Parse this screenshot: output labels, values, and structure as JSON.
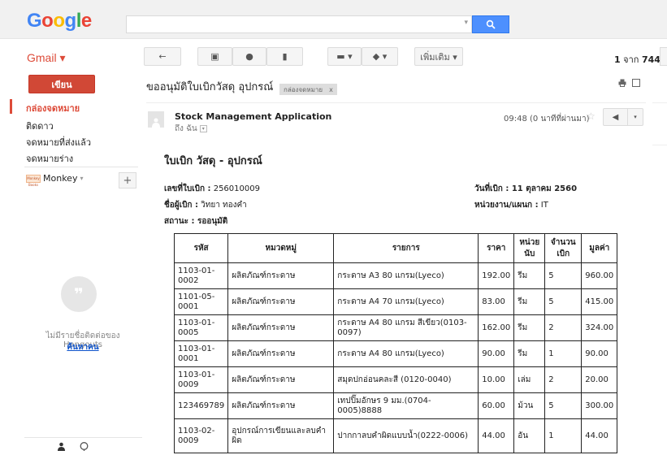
{
  "header": {
    "logo_letters": [
      {
        "ch": "G",
        "color": "#4285f4"
      },
      {
        "ch": "o",
        "color": "#ea4335"
      },
      {
        "ch": "o",
        "color": "#fbbc05"
      },
      {
        "ch": "g",
        "color": "#4285f4"
      },
      {
        "ch": "l",
        "color": "#34a853"
      },
      {
        "ch": "e",
        "color": "#ea4335"
      }
    ],
    "search_value": "",
    "search_icon": "search-icon"
  },
  "toolbar": {
    "gmail_label": "Gmail ▾",
    "back_icon": "←",
    "archive_icon": "▣",
    "spam_icon": "●",
    "delete_icon": "▮",
    "move_icon": "▬ ▾",
    "label_icon": "◆ ▾",
    "more_label": "เพิ่มเติม ▾",
    "pager_current": "1",
    "pager_text": "จาก",
    "pager_total": "744"
  },
  "sidebar": {
    "compose_label": "เขียน",
    "items": [
      {
        "label": "กล่องจดหมาย",
        "active": true
      },
      {
        "label": "ติดดาว",
        "active": false
      },
      {
        "label": "จดหมายที่ส่งแล้ว",
        "active": false
      },
      {
        "label": "จดหมายร่าง",
        "active": false
      }
    ],
    "account_logo_text": "Monkey Books",
    "account_name": "Monkey",
    "account_caret": "▾",
    "add_label": "+",
    "hangouts_empty": "ไม่มีรายชื่อติดต่อของ Hangouts",
    "find_people": "ค้นหาคน"
  },
  "email": {
    "subject": "ขออนุมัติใบเบิกวัสดุ อุปกรณ์",
    "chip_label": "กล่องจดหมาย",
    "chip_close": "x",
    "sender": "Stock Management Application",
    "to_label": "ถึง ฉัน",
    "to_caret": "▾",
    "time": "09:48 (0 นาทีที่ผ่านมา)",
    "star": "☆",
    "reply_icon": "◀",
    "more_caret": "▾"
  },
  "document": {
    "title": "ใบเบิก วัสดุ - อุปกรณ์",
    "req_no_label": "เลขที่ใบเบิก :",
    "req_no_value": "256010009",
    "requester_label": "ชื่อผู้เบิก :",
    "requester_value": "วิทยา ทองคำ",
    "status_label": "สถานะ : รออนุมัติ",
    "date_label": "วันที่เบิก : 11 ตุลาคม 2560",
    "dept_label": "หน่วยงาน/แผนก :",
    "dept_value": "IT",
    "columns": [
      "รหัส",
      "หมวดหมู่",
      "รายการ",
      "ราคา",
      "หน่วยนับ",
      "จำนวนเบิก",
      "มูลค่า"
    ],
    "rows": [
      [
        "1103-01-0002",
        "ผลิตภัณฑ์กระดาษ",
        "กระดาษ A3 80 แกรม(Lyeco)",
        "192.00",
        "รีม",
        "5",
        "960.00"
      ],
      [
        "1101-05-0001",
        "ผลิตภัณฑ์กระดาษ",
        "กระดาษ A4 70 แกรม(Lyeco)",
        "83.00",
        "รีม",
        "5",
        "415.00"
      ],
      [
        "1103-01-0005",
        "ผลิตภัณฑ์กระดาษ",
        "กระดาษ A4 80 แกรม สีเขียว(0103-0097)",
        "162.00",
        "รีม",
        "2",
        "324.00"
      ],
      [
        "1103-01-0001",
        "ผลิตภัณฑ์กระดาษ",
        "กระดาษ A4 80 แกรม(Lyeco)",
        "90.00",
        "รีม",
        "1",
        "90.00"
      ],
      [
        "1103-01-0009",
        "ผลิตภัณฑ์กระดาษ",
        "สมุดปกอ่อนคละสี (0120-0040)",
        "10.00",
        "เล่ม",
        "2",
        "20.00"
      ],
      [
        "123469789",
        "ผลิตภัณฑ์กระดาษ",
        "เทปปิ๊มอักษร 9 มม.(0704-0005)8888",
        "60.00",
        "ม้วน",
        "5",
        "300.00"
      ],
      [
        "1103-02-0009",
        "อุปกรณ์การเขียนและลบคำผิด",
        "ปากกาลบคำผิดแบบน้ำ(0222-0006)",
        "44.00",
        "อัน",
        "1",
        "44.00"
      ]
    ]
  }
}
